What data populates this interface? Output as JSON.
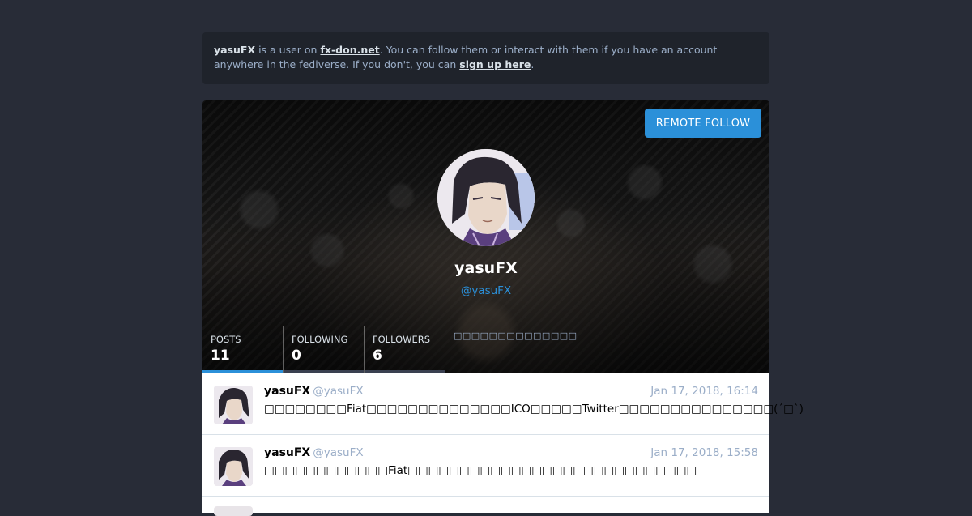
{
  "banner": {
    "user": "yasuFX",
    "text1": " is a user on ",
    "instance": "fx-don.net",
    "text2": ". You can follow them or interact with them if you have an account anywhere in the fediverse. If you don't, you can ",
    "signup": "sign up here",
    "text3": "."
  },
  "profile": {
    "remote_follow": "REMOTE FOLLOW",
    "display_name": "yasuFX",
    "acct": "@yasuFX",
    "bio": "□□□□□□□□□□□□□□",
    "counters": [
      {
        "label": "POSTS",
        "value": "11"
      },
      {
        "label": "FOLLOWING",
        "value": "0"
      },
      {
        "label": "FOLLOWERS",
        "value": "6"
      }
    ]
  },
  "statuses": [
    {
      "display_name": "yasuFX",
      "acct": "@yasuFX",
      "time": "Jan 17, 2018, 16:14",
      "content": "□□□□□□□□Fiat□□□□□□□□□□□□□□ICO□□□□□Twitter□□□□□□□□□□□□□□□(´□`)"
    },
    {
      "display_name": "yasuFX",
      "acct": "@yasuFX",
      "time": "Jan 17, 2018, 15:58",
      "content": "□□□□□□□□□□□□Fiat□□□□□□□□□□□□□□□□□□□□□□□□□□□□"
    }
  ],
  "colors": {
    "background": "#282c37",
    "accent": "#2b90d9",
    "muted": "#9baec8"
  }
}
